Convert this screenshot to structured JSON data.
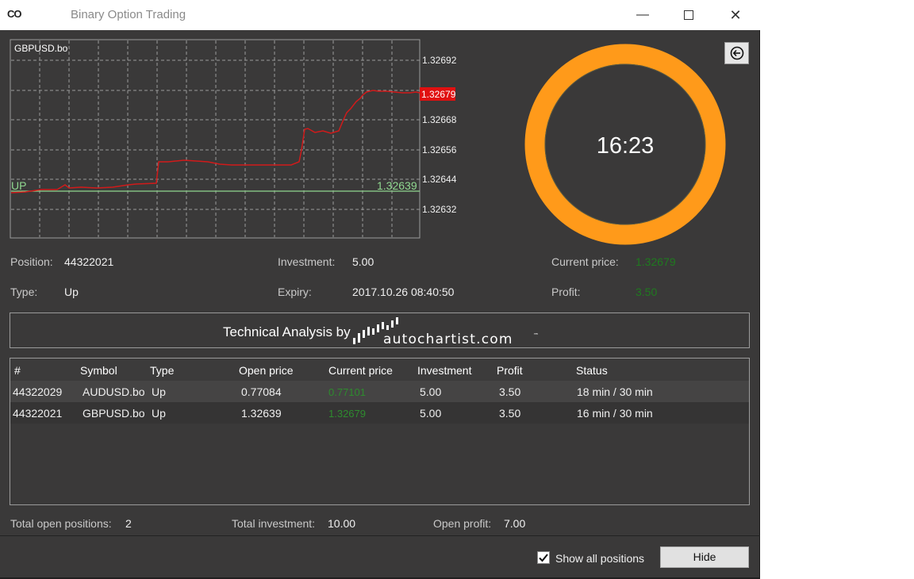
{
  "window": {
    "icon_text": "CO",
    "title": "Binary Option Trading",
    "minimize_label": "—",
    "close_label": "✕"
  },
  "chart": {
    "symbol": "GBPUSD.bo",
    "y_ticks": [
      "1.32692",
      "1.32668",
      "1.32656",
      "1.32644",
      "1.32632"
    ],
    "current_price_tag": "1.32679",
    "open_line_label": "UP",
    "open_line_value": "1.32639",
    "colors": {
      "price_line": "#d11a1a",
      "open_line": "#90d890",
      "tag_bg": "#e01010",
      "grid": "#9a9a9a"
    }
  },
  "timer": {
    "text": "16:23",
    "elapsed_fraction": 0.546,
    "colors": {
      "remaining": "#ff9a1a",
      "elapsed": "#6a6a6a"
    }
  },
  "position": {
    "position_label": "Position:",
    "position_value": "44322021",
    "type_label": "Type:",
    "type_value": "Up",
    "investment_label": "Investment:",
    "investment_value": "5.00",
    "expiry_label": "Expiry:",
    "expiry_value": "2017.10.26 08:40:50",
    "current_price_label": "Current price:",
    "current_price_value": "1.32679",
    "profit_label": "Profit:",
    "profit_value": "3.50"
  },
  "technical_analysis": {
    "text": "Technical Analysis by",
    "logo_text": "autochartist.com",
    "logo_tm": "™"
  },
  "table": {
    "headers": [
      "#",
      "Symbol",
      "Type",
      "Open price",
      "Current price",
      "Investment",
      "Profit",
      "Status"
    ],
    "rows": [
      [
        "44322029",
        "AUDUSD.bo",
        "Up",
        "0.77084",
        "0.77101",
        "5.00",
        "3.50",
        "18 min / 30 min"
      ],
      [
        "44322021",
        "GBPUSD.bo",
        "Up",
        "1.32639",
        "1.32679",
        "5.00",
        "3.50",
        "16 min / 30 min"
      ]
    ]
  },
  "totals": {
    "open_positions_label": "Total open positions:",
    "open_positions_value": "2",
    "investment_label": "Total investment:",
    "investment_value": "10.00",
    "profit_label": "Open profit:",
    "profit_value": "7.00"
  },
  "footer": {
    "show_all_label": "Show all positions",
    "show_all_checked": true,
    "hide_label": "Hide"
  }
}
